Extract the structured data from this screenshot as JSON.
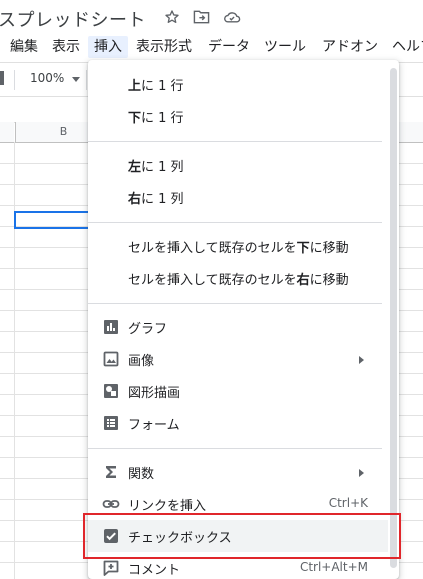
{
  "title_bar": {
    "doc_title": "スプレッドシート"
  },
  "menu_bar": {
    "items": [
      "編集",
      "表示",
      "挿入",
      "表示形式",
      "データ",
      "ツール",
      "アドオン",
      "ヘルプ"
    ],
    "active": "挿入"
  },
  "toolbar": {
    "zoom": "100%"
  },
  "grid": {
    "column_b": "B"
  },
  "insert_menu": {
    "rows": {
      "row_above": {
        "bold": "上",
        "rest": "に 1 行"
      },
      "row_below": {
        "bold": "下",
        "rest": "に 1 行"
      }
    },
    "columns": {
      "col_left": {
        "bold": "左",
        "rest": "に 1 列"
      },
      "col_right": {
        "bold": "右",
        "rest": "に 1 列"
      }
    },
    "shift": {
      "down": {
        "prefix": "セルを挿入して既存のセルを",
        "bold": "下",
        "suffix": "に移動"
      },
      "right": {
        "prefix": "セルを挿入して既存のセルを",
        "bold": "右",
        "suffix": "に移動"
      }
    },
    "objects": {
      "chart": "グラフ",
      "image": "画像",
      "drawing": "図形描画",
      "form": "フォーム"
    },
    "function": "関数",
    "link": {
      "label": "リンクを挿入",
      "shortcut": "Ctrl+K"
    },
    "checkbox": "チェックボックス",
    "comment": {
      "label": "コメント",
      "shortcut": "Ctrl+Alt+M"
    }
  }
}
